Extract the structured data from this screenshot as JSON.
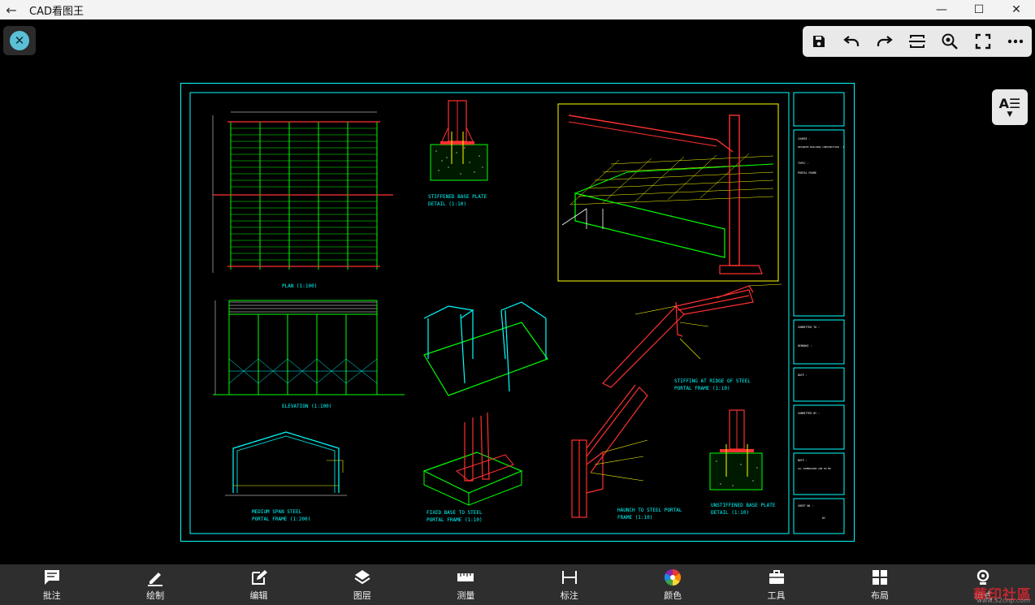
{
  "app": {
    "title": "CAD看图王",
    "back_icon": "back-arrow-icon",
    "window_controls": [
      "minimize-icon",
      "maximize-icon",
      "close-icon"
    ]
  },
  "top_toolbar": {
    "icons": [
      "save-icon",
      "undo-icon",
      "redo-icon",
      "fit-width-icon",
      "zoom-icon",
      "fullscreen-icon",
      "more-icon"
    ]
  },
  "text_panel_button": {
    "icon": "text-style-icon",
    "label": "A☰"
  },
  "drawing": {
    "plan_title": "PLAN (1:100)",
    "elevation_title": "ELEVATION   (1:100)",
    "stiffened_base_title": "STIFFENED BASE PLATE",
    "stiffened_base_scale": "DETAIL (1:10)",
    "ridge_title": "STIFFING AT RIDGE OF STEEL",
    "ridge_scale": "PORTAL FRAME (1:10)",
    "midspan_title": "MEDIUM  SPAN STEEL",
    "midspan_scale": "PORTAL FRAME (1:200)",
    "fixed_base_title": "FIXED BASE TO STEEL",
    "fixed_base_scale": "PORTAL FRAME (1:10)",
    "haunch_title": "HAUNCH TO STEEL PORTAL",
    "haunch_scale": "FRAME (1:10)",
    "unstiffened_title": "UNSTIFFENED BASE PLATE",
    "unstiffened_scale": "DETAIL (1:10)",
    "titleblock": {
      "course_label": "COURSE :",
      "course_value": "ADVANCED BUILDING CONSTRUCTION - I",
      "topic_label": "TOPIC :",
      "topic_value": "PORTAL FRAME",
      "submitted_to": "SUBMITTED TO :",
      "remarks": "REMARKS :",
      "date": "DATE :",
      "submitted_by": "SUBMITTED BY :",
      "note": "NOTE :",
      "note_value": "ALL DIMENSIONS ARE IN MM",
      "sheet_no": "SHEET NO :",
      "sheet_value": "02"
    }
  },
  "bottom_bar": {
    "items": [
      {
        "icon": "comment-icon",
        "label": "批注"
      },
      {
        "icon": "pencil-icon",
        "label": "绘制"
      },
      {
        "icon": "edit-icon",
        "label": "编辑"
      },
      {
        "icon": "layers-icon",
        "label": "图层"
      },
      {
        "icon": "ruler-icon",
        "label": "测量"
      },
      {
        "icon": "dimension-icon",
        "label": "标注"
      },
      {
        "icon": "color-wheel-icon",
        "label": "颜色"
      },
      {
        "icon": "toolbox-icon",
        "label": "工具"
      },
      {
        "icon": "layout-icon",
        "label": "布局"
      },
      {
        "icon": "settings-icon",
        "label": "样式"
      }
    ]
  },
  "watermark": {
    "text": "華印社區",
    "url": "www.52cnp.com"
  }
}
